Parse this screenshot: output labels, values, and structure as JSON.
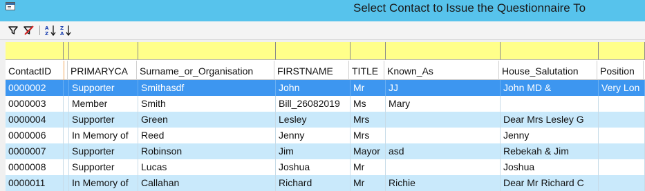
{
  "window": {
    "title": "Select Contact to Issue the Questionnaire To"
  },
  "toolbar": {
    "icons": [
      "filter-icon",
      "clear-filter-icon",
      "sort-ascending-icon",
      "sort-descending-icon"
    ]
  },
  "grid": {
    "columns": [
      "ContactID",
      "",
      "PRIMARYCA",
      "Surname_or_Organisation",
      "FIRSTNAME",
      "TITLE",
      "Known_As",
      "House_Salutation",
      "Position"
    ],
    "rows": [
      {
        "id": "0000002",
        "primary": "Supporter",
        "surname": "Smithasdf",
        "firstname": "John",
        "title": "Mr",
        "known_as": "JJ",
        "salutation": "John MD &",
        "position": "Very Lon"
      },
      {
        "id": "0000003",
        "primary": "Member",
        "surname": "Smith",
        "firstname": "Bill_26082019",
        "title": "Ms",
        "known_as": "Mary",
        "salutation": "",
        "position": ""
      },
      {
        "id": "0000004",
        "primary": "Supporter",
        "surname": "Green",
        "firstname": "Lesley",
        "title": "Mrs",
        "known_as": "",
        "salutation": "Dear Mrs Lesley G",
        "position": ""
      },
      {
        "id": "0000006",
        "primary": "In Memory of",
        "surname": "Reed",
        "firstname": "Jenny",
        "title": "Mrs",
        "known_as": "",
        "salutation": "Jenny",
        "position": ""
      },
      {
        "id": "0000007",
        "primary": "Supporter",
        "surname": "Robinson",
        "firstname": "Jim",
        "title": "Mayor",
        "known_as": "asd",
        "salutation": "Rebekah & Jim",
        "position": ""
      },
      {
        "id": "0000008",
        "primary": "Supporter",
        "surname": "Lucas",
        "firstname": "Joshua",
        "title": "Mr",
        "known_as": "",
        "salutation": "Joshua",
        "position": ""
      },
      {
        "id": "0000011",
        "primary": "In Memory of",
        "surname": "Callahan",
        "firstname": "Richard",
        "title": "Mr",
        "known_as": "Richie",
        "salutation": "Dear Mr Richard C",
        "position": ""
      }
    ],
    "selected_row_index": 0
  },
  "colors": {
    "titlebar": "#57c3ec",
    "filter_row": "#ffff8a",
    "selected_row": "#3d96f0",
    "alt_row": "#c9e9fb"
  }
}
